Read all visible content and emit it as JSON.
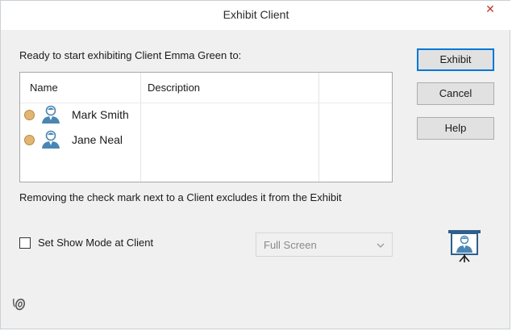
{
  "window": {
    "title": "Exhibit Client",
    "close_glyph": "✕"
  },
  "prompt": "Ready to start exhibiting Client Emma Green to:",
  "list": {
    "columns": [
      "Name",
      "Description"
    ],
    "rows": [
      {
        "name": "Mark Smith",
        "description": "",
        "status_color": "#e2b572",
        "icon": "user-icon"
      },
      {
        "name": "Jane Neal",
        "description": "",
        "status_color": "#e2b572",
        "icon": "user-icon"
      }
    ]
  },
  "buttons": {
    "exhibit": "Exhibit",
    "cancel": "Cancel",
    "help": "Help"
  },
  "info_text": "Removing the check mark next to a Client excludes it from the Exhibit",
  "show_mode": {
    "label": "Set Show Mode at Client",
    "checked": false,
    "dropdown_value": "Full Screen",
    "dropdown_enabled": false
  },
  "icons": {
    "exhibit": "presentation-user-icon",
    "corner": "gesture-icon"
  },
  "colors": {
    "accent": "#0078d7",
    "user_icon": "#4a86b4",
    "close": "#c0392b"
  }
}
